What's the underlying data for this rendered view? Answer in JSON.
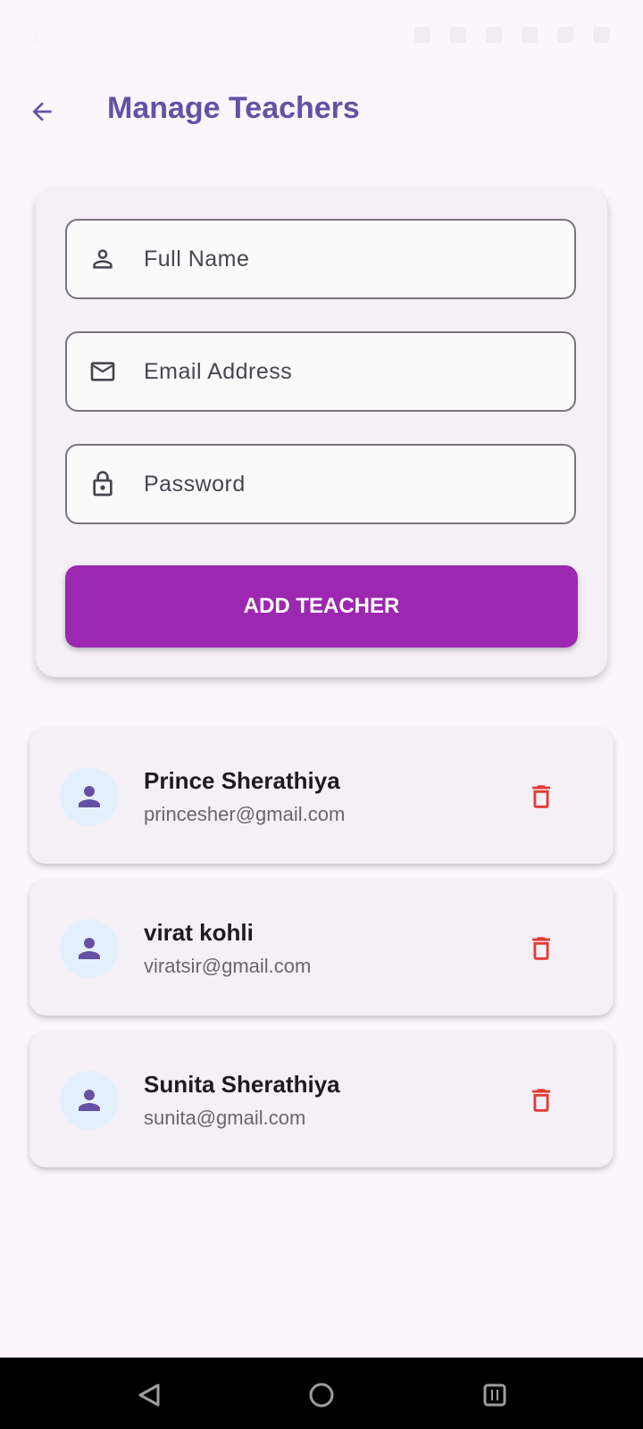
{
  "status_bar": {
    "time": "15:46"
  },
  "header": {
    "title": "Manage Teachers",
    "back_icon": "arrow-left-icon"
  },
  "form": {
    "fields": [
      {
        "placeholder": "Full Name",
        "value": "",
        "icon": "person-outline-icon"
      },
      {
        "placeholder": "Email Address",
        "value": "",
        "icon": "mail-icon"
      },
      {
        "placeholder": "Password",
        "value": "",
        "icon": "lock-icon"
      }
    ],
    "submit_label": "ADD TEACHER"
  },
  "teachers": [
    {
      "name": "Prince Sherathiya",
      "email": "princesher@gmail.com"
    },
    {
      "name": "virat kohli",
      "email": "viratsir@gmail.com"
    },
    {
      "name": "Sunita Sherathiya",
      "email": "sunita@gmail.com"
    }
  ],
  "colors": {
    "background": "#fcf6fc",
    "primary": "#6750a4",
    "button": "#9c27b0",
    "delete": "#e53935",
    "avatar_bg": "#e3f0fb"
  },
  "nav": {
    "back_icon": "nav-back-icon",
    "home_icon": "nav-home-icon",
    "recents_icon": "nav-recents-icon"
  }
}
